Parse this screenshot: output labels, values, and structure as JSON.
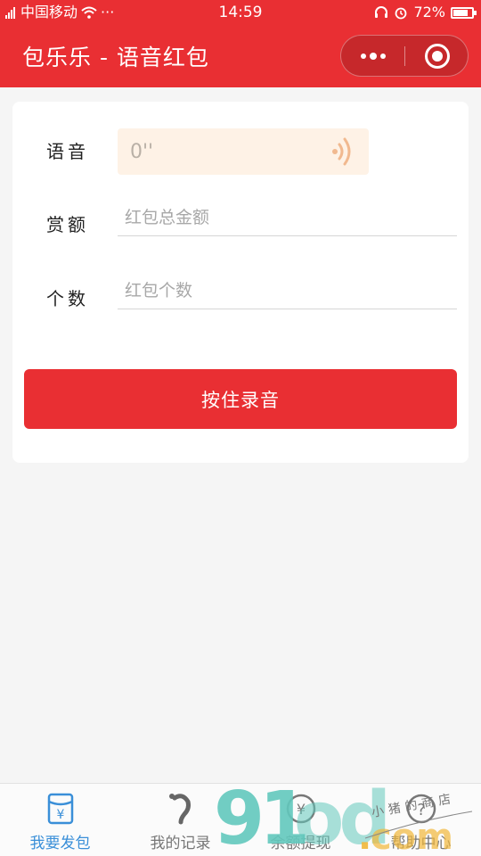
{
  "status_bar": {
    "carrier": "中国移动",
    "dots": "···",
    "time": "14:59",
    "battery": "72%",
    "battery_level": 0.72
  },
  "navbar": {
    "title": "包乐乐 - 语音红包"
  },
  "form": {
    "voice_label": "语音",
    "voice_value": "0''",
    "amount_label": "赏额",
    "amount_placeholder": "红包总金额",
    "amount_value": "",
    "count_label": "个数",
    "count_placeholder": "红包个数",
    "count_value": "",
    "record_button": "按住录音"
  },
  "tabbar": {
    "items": [
      {
        "label": "我要发包",
        "icon": "red-envelope-icon",
        "active": true
      },
      {
        "label": "我的记录",
        "icon": "ear-icon",
        "active": false
      },
      {
        "label": "余额提现",
        "icon": "withdraw-icon",
        "active": false
      },
      {
        "label": "帮助中心",
        "icon": "help-icon",
        "active": false
      }
    ]
  },
  "watermark": {
    "text": "91od.com",
    "subtext": "小猪的商店"
  },
  "colors": {
    "brand_red": "#e92f33",
    "active_tab": "#3a8fd8",
    "voice_bg": "#fef2e6"
  }
}
